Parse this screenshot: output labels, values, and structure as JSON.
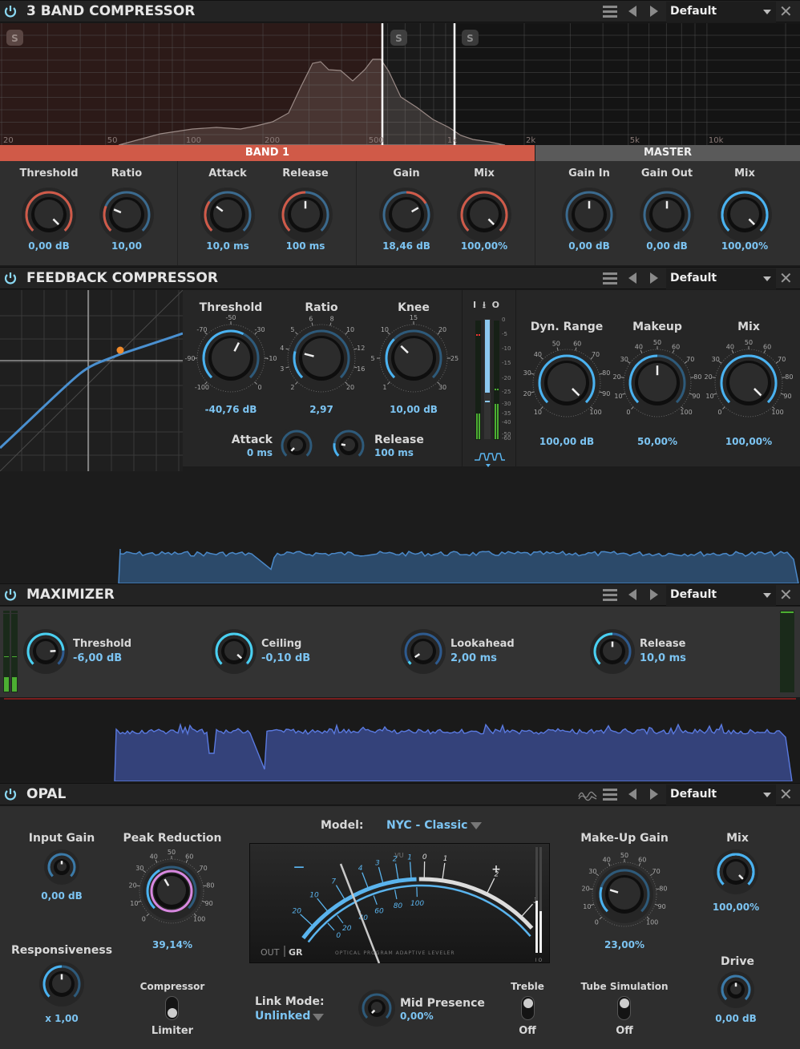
{
  "colors": {
    "accent": "#5ab4ee",
    "band": "#d05a48",
    "master": "#5a5a5a",
    "value_text": "#7cc4f2"
  },
  "header_common": {
    "menu_icon": "hamburger-icon",
    "prev_icon": "arrow-left-icon",
    "next_icon": "arrow-right-icon",
    "close_icon": "close-icon",
    "close_glyph": "✕"
  },
  "band3": {
    "title": "3 BAND COMPRESSOR",
    "preset": "Default",
    "solo_label": "S",
    "freq_ticks": [
      "20",
      "50",
      "100",
      "200",
      "500",
      "1k",
      "2k",
      "5k",
      "10k"
    ],
    "bands": [
      {
        "label": "BAND 1",
        "active": true
      },
      {
        "label": "MASTER",
        "active": false
      }
    ],
    "knobs": [
      {
        "label": "Threshold",
        "value": "0,00 dB",
        "position": 1.0
      },
      {
        "label": "Ratio",
        "value": "10,00",
        "position": 0.25
      },
      {
        "label": "Attack",
        "value": "10,0 ms",
        "position": 0.3
      },
      {
        "label": "Release",
        "value": "100 ms",
        "position": 0.5
      },
      {
        "label": "Gain",
        "value": "18,46 dB",
        "position": 0.72
      },
      {
        "label": "Mix",
        "value": "100,00%",
        "position": 1.0
      },
      {
        "label": "Gain In",
        "value": "0,00 dB",
        "position": 0.5
      },
      {
        "label": "Gain Out",
        "value": "0,00 dB",
        "position": 0.5
      },
      {
        "label": "Mix",
        "value": "100,00%",
        "position": 1.0
      }
    ]
  },
  "feedback": {
    "title": "FEEDBACK COMPRESSOR",
    "preset": "Default",
    "threshold": {
      "label": "Threshold",
      "value": "-40,76 dB",
      "scale": [
        "-100",
        "-90",
        "-70",
        "-50",
        "-30",
        "-10",
        "0"
      ],
      "position": 0.6
    },
    "ratio": {
      "label": "Ratio",
      "value": "2,97",
      "scale": [
        "2",
        "3",
        "4",
        "5",
        "6",
        "8",
        "10",
        "12",
        "16",
        "20"
      ],
      "position": 0.22
    },
    "knee": {
      "label": "Knee",
      "value": "10,00 dB",
      "scale": [
        "1",
        "5",
        "10",
        "15",
        "20",
        "25",
        "30"
      ],
      "position": 0.33
    },
    "attack": {
      "label": "Attack",
      "value": "0 ms",
      "position": 0.0
    },
    "release": {
      "label": "Release",
      "value": "100 ms",
      "position": 0.2
    },
    "meter": {
      "header": [
        "I",
        "⭳",
        "O"
      ],
      "scale": [
        "0",
        "-5",
        "-10",
        "-15",
        "-20",
        "-25",
        "-30",
        "-35",
        "-40",
        "-50",
        "-60"
      ],
      "gr_level": 0.63
    },
    "dyn_range": {
      "label": "Dyn. Range",
      "value": "100,00 dB",
      "scale": [
        "10",
        "20",
        "30",
        "40",
        "50",
        "60",
        "70",
        "80",
        "90",
        "100"
      ],
      "position": 1.0
    },
    "makeup": {
      "label": "Makeup",
      "value": "50,00%",
      "scale": [
        "0",
        "10",
        "20",
        "30",
        "40",
        "50",
        "60",
        "70",
        "80",
        "90",
        "100"
      ],
      "position": 0.5
    },
    "mix": {
      "label": "Mix",
      "value": "100,00%",
      "scale": [
        "0",
        "10",
        "20",
        "30",
        "40",
        "50",
        "60",
        "70",
        "80",
        "90",
        "100"
      ],
      "position": 1.0
    }
  },
  "maximizer": {
    "title": "MAXIMIZER",
    "preset": "Default",
    "knobs": [
      {
        "label": "Threshold",
        "value": "-6,00 dB",
        "position": 0.82
      },
      {
        "label": "Ceiling",
        "value": "-0,10 dB",
        "position": 0.99
      },
      {
        "label": "Lookahead",
        "value": "2,00 ms",
        "position": 0.04
      },
      {
        "label": "Release",
        "value": "10,0 ms",
        "position": 0.5
      }
    ]
  },
  "opal": {
    "title": "OPAL",
    "preset": "Default",
    "input_gain": {
      "label": "Input Gain",
      "value": "0,00 dB",
      "position": 0.5
    },
    "peak_reduction": {
      "label": "Peak Reduction",
      "value": "39,14%",
      "scale": [
        "0",
        "10",
        "20",
        "30",
        "40",
        "50",
        "60",
        "70",
        "80",
        "90",
        "100"
      ],
      "position": 0.39
    },
    "responsiveness": {
      "label": "Responsiveness",
      "value": "x 1,00",
      "position": 0.5
    },
    "model": {
      "label": "Model:",
      "value": "NYC - Classic"
    },
    "vu": {
      "title": "VU",
      "minus": "—",
      "plus": "+",
      "gr_scale": [
        "20",
        "10",
        "7",
        "4",
        "3",
        "2",
        "1",
        "0",
        "1",
        "2",
        "3"
      ],
      "out_scale": [
        "0",
        "20",
        "40",
        "60",
        "80",
        "100"
      ],
      "mode_out": "OUT",
      "mode_gr": "GR",
      "caption": "OPTICAL PROGRAM ADAPTIVE LEVELER",
      "meter_label": "I O"
    },
    "makeup": {
      "label": "Make-Up Gain",
      "value": "23,00%",
      "scale": [
        "0",
        "10",
        "20",
        "30",
        "40",
        "50",
        "60",
        "70",
        "80",
        "90",
        "100"
      ],
      "position": 0.23
    },
    "mix": {
      "label": "Mix",
      "value": "100,00%",
      "position": 1.0
    },
    "comp_switch": {
      "top": "Compressor",
      "bottom": "Limiter",
      "state": "Limiter"
    },
    "link_mode": {
      "label": "Link Mode:",
      "value": "Unlinked"
    },
    "mid_presence": {
      "label": "Mid Presence",
      "value": "0,00%",
      "position": 0.0
    },
    "treble": {
      "label": "Treble",
      "value": "Off"
    },
    "tube": {
      "label": "Tube Simulation",
      "value": "Off"
    },
    "drive": {
      "label": "Drive",
      "value": "0,00 dB",
      "position": 0.5
    }
  }
}
